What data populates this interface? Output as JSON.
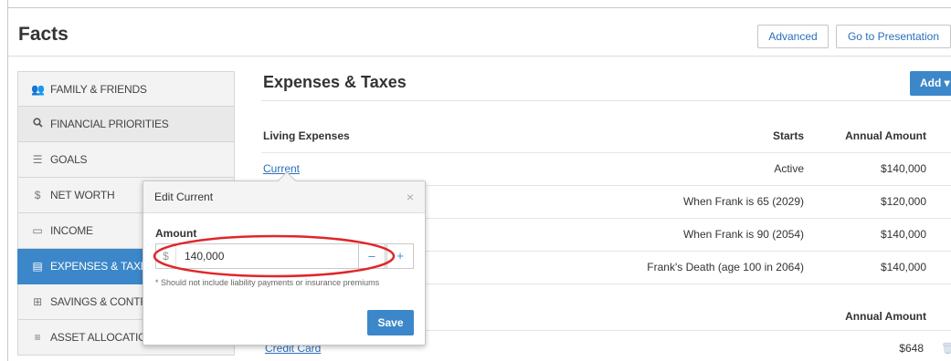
{
  "page": {
    "title": "Facts"
  },
  "header_buttons": {
    "advanced": "Advanced",
    "presentation": "Go to Presentation"
  },
  "sidebar": {
    "items": [
      {
        "label": "FAMILY & FRIENDS",
        "icon": "people-icon",
        "glyph": "👥"
      },
      {
        "label": "FINANCIAL PRIORITIES",
        "icon": "search-icon",
        "glyph": "🔍"
      },
      {
        "label": "GOALS",
        "icon": "goals-icon",
        "glyph": "☰"
      },
      {
        "label": "NET WORTH",
        "icon": "dollar-icon",
        "glyph": "$"
      },
      {
        "label": "INCOME",
        "icon": "income-icon",
        "glyph": "▭"
      },
      {
        "label": "EXPENSES & TAXES",
        "icon": "expenses-icon",
        "glyph": "▤"
      },
      {
        "label": "SAVINGS & CONTRIBUTIONS",
        "icon": "plus-square-icon",
        "glyph": "⊞"
      },
      {
        "label": "ASSET ALLOCATION",
        "icon": "allocation-icon",
        "glyph": "≡"
      }
    ],
    "active_index": 5
  },
  "main": {
    "title": "Expenses & Taxes",
    "add_label": "Add ▾",
    "living": {
      "headers": {
        "name": "Living Expenses",
        "starts": "Starts",
        "amount": "Annual Amount"
      },
      "rows": [
        {
          "name": "Current",
          "starts": "Active",
          "amount": "$140,000"
        },
        {
          "name": "",
          "starts": "When Frank is 65 (2029)",
          "amount": "$120,000"
        },
        {
          "name": "",
          "starts": "When Frank is 90 (2054)",
          "amount": "$140,000"
        },
        {
          "name": "",
          "starts": "Frank's Death (age 100 in 2064)",
          "amount": "$140,000"
        }
      ]
    },
    "debts": {
      "header_amount": "Annual Amount",
      "rows": [
        {
          "name": "Credit Card",
          "amount": "$648"
        }
      ]
    }
  },
  "popover": {
    "title": "Edit Current",
    "close_glyph": "×",
    "amount_label": "Amount",
    "currency_symbol": "$",
    "value": "140,000",
    "minus": "–",
    "plus": "+",
    "note": "* Should not include liability payments or insurance premiums",
    "save": "Save"
  },
  "colors": {
    "accent": "#3c87c9",
    "link": "#2a6ebb",
    "highlight": "#e0262a"
  }
}
